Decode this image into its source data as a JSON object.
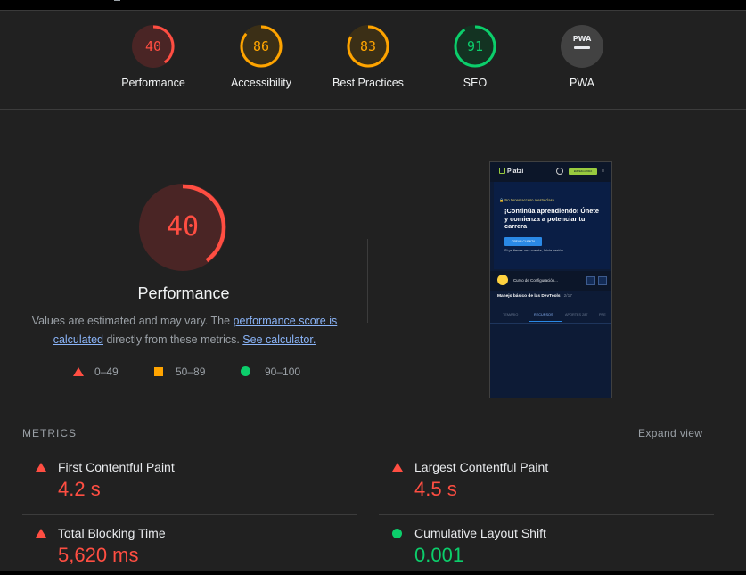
{
  "categories": [
    {
      "label": "Performance",
      "score": "40",
      "value": 0.4,
      "color": "#ff4e42",
      "bg": "#4a2525"
    },
    {
      "label": "Accessibility",
      "score": "86",
      "value": 0.86,
      "color": "#ffa400",
      "bg": "#3b2f16"
    },
    {
      "label": "Best Practices",
      "score": "83",
      "value": 0.83,
      "color": "#ffa400",
      "bg": "#3b2f16"
    },
    {
      "label": "SEO",
      "score": "91",
      "value": 0.91,
      "color": "#0cce6b",
      "bg": "#133322"
    },
    {
      "label": "PWA",
      "score": "PWA",
      "icon": "pwa-badge-icon",
      "color": "#e8eaed",
      "bg": "#424242"
    }
  ],
  "performance": {
    "score": "40",
    "value": 0.4,
    "title": "Performance",
    "desc_prefix": "Values are estimated and may vary. The ",
    "desc_link1": "performance score is calculated",
    "desc_middle": " directly from these metrics. ",
    "desc_link2": "See calculator."
  },
  "legend": [
    {
      "label": "0–49",
      "icon": "triangle-icon",
      "color": "#ff4e42"
    },
    {
      "label": "50–89",
      "icon": "square-icon",
      "color": "#ffa400"
    },
    {
      "label": "90–100",
      "icon": "circle-icon",
      "color": "#0cce6b"
    }
  ],
  "screenshot": {
    "logo": "Platzi",
    "cta": "EMPIEZA AHORA",
    "warning": "No tienes acceso a esta clase",
    "headline": "¡Continúa aprendiendo! Únete y comienza a potenciar tu carrera",
    "button": "CREAR CUENTA",
    "login": "Si ya tienes una cuenta, Inicia sesión",
    "course": "Curso de Configuración...",
    "lesson": "Manejo básico de las DevTools",
    "lesson_count": "2/17",
    "tabs": [
      "TEMARIO",
      "RECURSOS",
      "APORTES 287",
      "PRE"
    ]
  },
  "metrics": {
    "header": "METRICS",
    "expand": "Expand view",
    "items": [
      {
        "title": "First Contentful Paint",
        "value": "4.2 s",
        "status": "fail"
      },
      {
        "title": "Largest Contentful Paint",
        "value": "4.5 s",
        "status": "fail"
      },
      {
        "title": "Total Blocking Time",
        "value": "5,620 ms",
        "status": "fail"
      },
      {
        "title": "Cumulative Layout Shift",
        "value": "0.001",
        "status": "pass"
      }
    ]
  }
}
